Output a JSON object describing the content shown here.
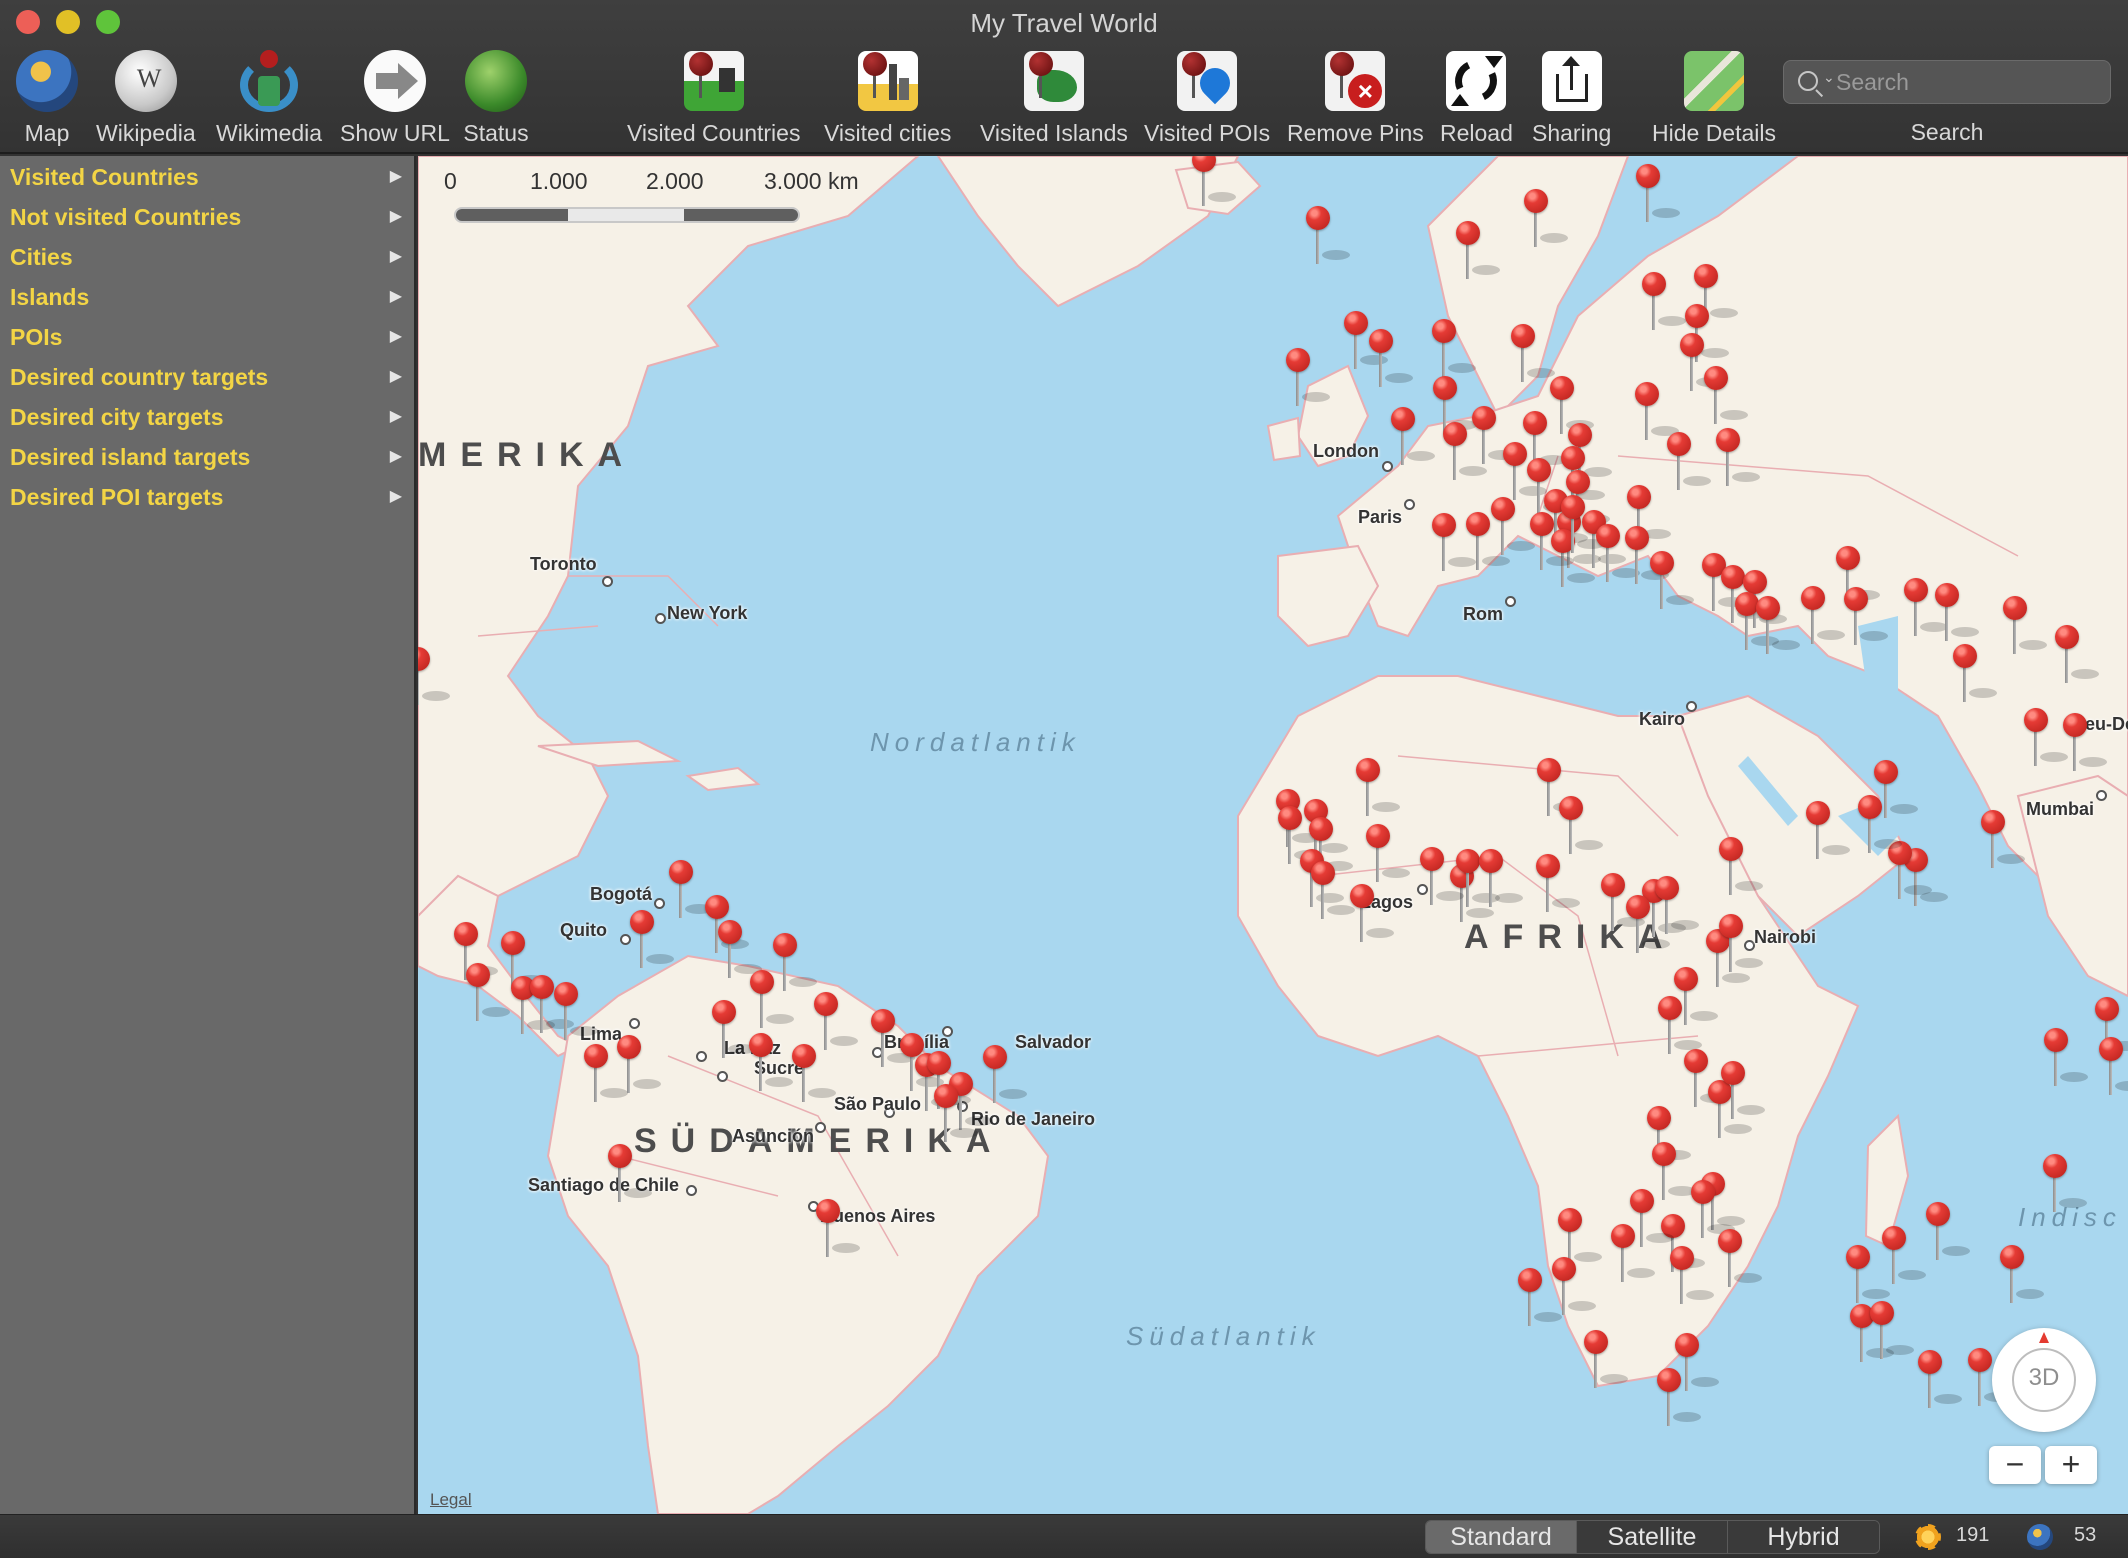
{
  "window": {
    "title": "My Travel World"
  },
  "toolbar": {
    "map_label": "Map",
    "wikipedia_label": "Wikipedia",
    "wikimedia_label": "Wikimedia",
    "show_url_label": "Show URL",
    "status_label": "Status",
    "visited_countries_label": "Visited Countries",
    "visited_cities_label": "Visited cities",
    "visited_islands_label": "Visited Islands",
    "visited_pois_label": "Visited POIs",
    "remove_pins_label": "Remove Pins",
    "reload_label": "Reload",
    "sharing_label": "Sharing",
    "hide_details_label": "Hide Details",
    "search_placeholder": "Search",
    "search_label": "Search"
  },
  "sidebar": {
    "items": [
      {
        "label": "Visited Countries"
      },
      {
        "label": "Not visited Countries"
      },
      {
        "label": "Cities"
      },
      {
        "label": "Islands"
      },
      {
        "label": "POIs"
      },
      {
        "label": "Desired country targets"
      },
      {
        "label": "Desired city targets"
      },
      {
        "label": "Desired island targets"
      },
      {
        "label": "Desired POI targets"
      }
    ]
  },
  "map": {
    "scale": {
      "ticks": [
        "0",
        "1.000",
        "2.000",
        "3.000 km"
      ]
    },
    "continents": {
      "north_america": "MERIKA",
      "south_america": "SÜDAMERIKA",
      "africa": "AFRIKA"
    },
    "oceans": {
      "north_atlantic": "Nordatlantik",
      "south_atlantic": "Südatlantik",
      "indian": "Indisc"
    },
    "cities": {
      "toronto": "Toronto",
      "new_york": "New York",
      "london": "London",
      "paris": "Paris",
      "rome": "Rom",
      "cairo": "Kairo",
      "new_delhi": "Neu-Delh",
      "mumbai": "Mumbai",
      "lagos": "Lagos",
      "nairobi": "Nairobi",
      "bogota": "Bogotá",
      "quito": "Quito",
      "lima": "Lima",
      "la_paz": "La Paz",
      "sucre": "Sucre",
      "brasilia": "Brasília",
      "salvador": "Salvador",
      "sao_paulo": "São Paulo",
      "rio": "Rio de Janeiro",
      "asuncion": "Asunción",
      "santiago": "Santiago de Chile",
      "buenos_aires": "Buenos Aires"
    },
    "legal_label": "Legal",
    "compass_label": "3D",
    "zoom_out": "−",
    "zoom_in": "+"
  },
  "statusbar": {
    "map_types": [
      "Standard",
      "Satellite",
      "Hybrid"
    ],
    "selected_type": "Standard",
    "visited_count": "191",
    "countries_count": "53"
  },
  "colors": {
    "water": "#a9d7ef",
    "land": "#f6f1e7",
    "border": "#e9aeb2",
    "pin": "#e53b35",
    "sidebar_text": "#f3d545"
  }
}
